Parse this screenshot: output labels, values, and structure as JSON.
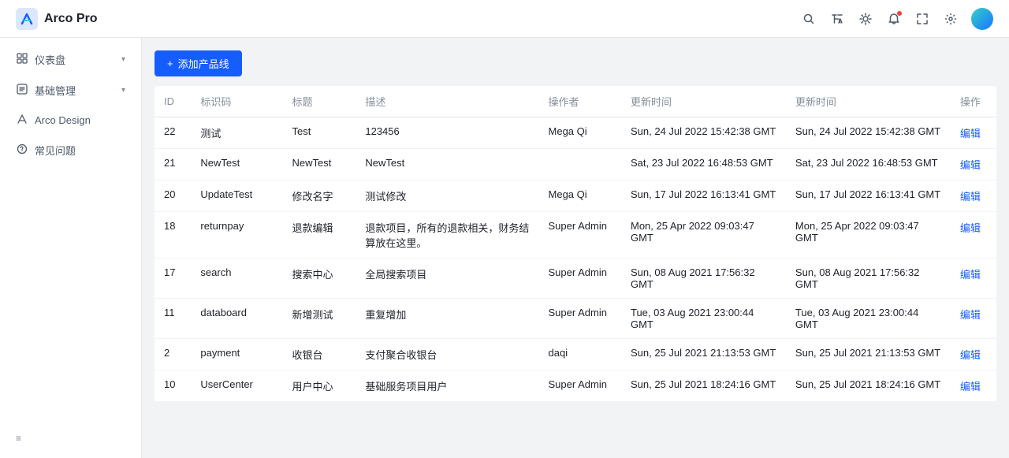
{
  "app": {
    "name": "Arco Pro"
  },
  "header": {
    "icons": [
      "search",
      "translate",
      "sun",
      "bell",
      "fullscreen",
      "settings"
    ],
    "notification_dot": true
  },
  "sidebar": {
    "items": [
      {
        "id": "dashboard",
        "label": "仪表盘",
        "icon": "📊",
        "has_sub": true
      },
      {
        "id": "basic-mgmt",
        "label": "基础管理",
        "icon": "🔧",
        "has_sub": true
      },
      {
        "id": "arco-design",
        "label": "Arco Design",
        "icon": "🔗",
        "has_sub": false
      },
      {
        "id": "faq",
        "label": "常见问题",
        "icon": "❓",
        "has_sub": false
      }
    ],
    "bottom_icon": "≡"
  },
  "toolbar": {
    "add_button_label": "添加产品线"
  },
  "table": {
    "columns": [
      "ID",
      "标识码",
      "标题",
      "描述",
      "操作者",
      "更新时间",
      "更新时间",
      "操作"
    ],
    "rows": [
      {
        "id": "22",
        "code": "测试",
        "title": "Test",
        "desc": "123456",
        "operator": "Mega Qi",
        "created": "Sun, 24 Jul 2022 15:42:38 GMT",
        "updated": "Sun, 24 Jul 2022 15:42:38 GMT",
        "action": "编辑"
      },
      {
        "id": "21",
        "code": "NewTest",
        "title": "NewTest",
        "desc": "NewTest",
        "operator": "",
        "created": "Sat, 23 Jul 2022 16:48:53 GMT",
        "updated": "Sat, 23 Jul 2022 16:48:53 GMT",
        "action": "编辑"
      },
      {
        "id": "20",
        "code": "UpdateTest",
        "title": "修改名字",
        "desc": "测试修改",
        "operator": "Mega Qi",
        "created": "Sun, 17 Jul 2022 16:13:41 GMT",
        "updated": "Sun, 17 Jul 2022 16:13:41 GMT",
        "action": "编辑"
      },
      {
        "id": "18",
        "code": "returnpay",
        "title": "退款编辑",
        "desc": "退款项目，所有的退款相关，财务结算放在这里。",
        "operator": "Super Admin",
        "created": "Mon, 25 Apr 2022 09:03:47 GMT",
        "updated": "Mon, 25 Apr 2022 09:03:47 GMT",
        "action": "编辑"
      },
      {
        "id": "17",
        "code": "search",
        "title": "搜索中心",
        "desc": "全局搜索项目",
        "operator": "Super Admin",
        "created": "Sun, 08 Aug 2021 17:56:32 GMT",
        "updated": "Sun, 08 Aug 2021 17:56:32 GMT",
        "action": "编辑"
      },
      {
        "id": "11",
        "code": "databoard",
        "title": "新增测试",
        "desc": "重复增加",
        "operator": "Super Admin",
        "created": "Tue, 03 Aug 2021 23:00:44 GMT",
        "updated": "Tue, 03 Aug 2021 23:00:44 GMT",
        "action": "编辑"
      },
      {
        "id": "2",
        "code": "payment",
        "title": "收银台",
        "desc": "支付聚合收银台",
        "operator": "daqi",
        "created": "Sun, 25 Jul 2021 21:13:53 GMT",
        "updated": "Sun, 25 Jul 2021 21:13:53 GMT",
        "action": "编辑"
      },
      {
        "id": "10",
        "code": "UserCenter",
        "title": "用户中心",
        "desc": "基础服务项目用户",
        "operator": "Super Admin",
        "created": "Sun, 25 Jul 2021 18:24:16 GMT",
        "updated": "Sun, 25 Jul 2021 18:24:16 GMT",
        "action": "编辑"
      }
    ]
  }
}
